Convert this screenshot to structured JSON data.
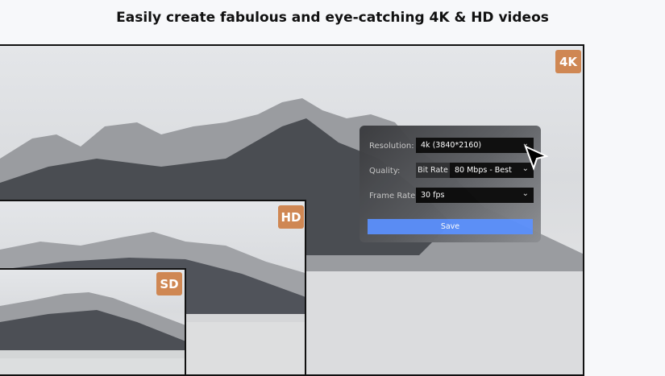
{
  "headline": "Easily create fabulous and eye-catching 4K & HD videos",
  "badges": {
    "k4": "4K",
    "hd": "HD",
    "sd": "SD"
  },
  "badge_color": "#cf8753",
  "settings": {
    "resolution_label": "Resolution:",
    "resolution_value": "4k (3840*2160)",
    "quality_label": "Quality:",
    "quality_mode": "Bit Rate",
    "quality_value": "80 Mbps - Best",
    "framerate_label": "Frame Rate:",
    "framerate_value": "30 fps",
    "save_label": "Save"
  },
  "accent": "#5b8ff9"
}
